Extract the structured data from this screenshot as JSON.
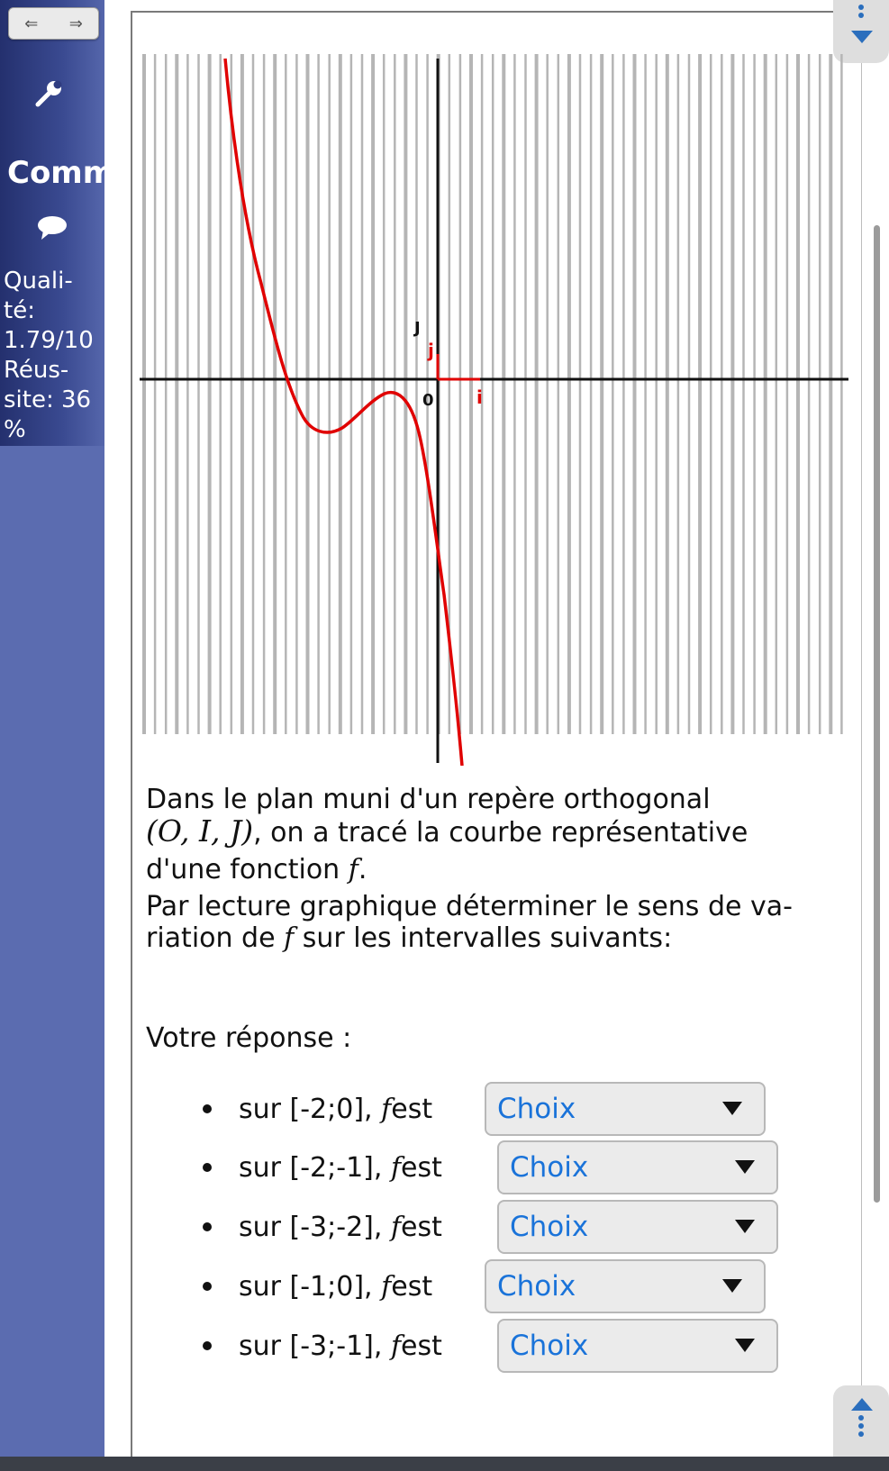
{
  "sidebar": {
    "nav_left": "⇐",
    "nav_right": "⇒",
    "section_title": "Comm",
    "stats_lines": [
      "Quali-",
      "té:",
      "1.79/10",
      "Réus-",
      "site: 36",
      "%"
    ],
    "colors": {
      "sidebar_top": "#24306e",
      "sidebar": "#5b6cb0"
    }
  },
  "graph": {
    "label_J_black": "J",
    "label_j_red": "j",
    "label_origin": "0",
    "label_i_red": "i",
    "curve_color": "#e00000",
    "grid_color": "#b5b5b5"
  },
  "question": {
    "line1": "Dans le plan muni d'un repère orthogonal",
    "line2_math": "(O, I, J)",
    "line2_text": ", on a tracé la courbe représentative",
    "line3_text": "d'une fonction ",
    "line3_math": "f",
    "line3_end": ".",
    "line4": "Par lecture graphique déterminer le sens de va-",
    "line5_start": "riation de ",
    "line5_math": "f",
    "line5_end": " sur les intervalles suivants:"
  },
  "answer_label": "Votre réponse :",
  "answers": [
    {
      "prefix": "sur [-2;0], ",
      "var": "f",
      "suffix": " est",
      "select_value": "Choix"
    },
    {
      "prefix": "sur [-2;-1], ",
      "var": "f",
      "suffix": " est",
      "select_value": "Choix"
    },
    {
      "prefix": "sur [-3;-2], ",
      "var": "f",
      "suffix": " est",
      "select_value": "Choix"
    },
    {
      "prefix": "sur [-1;0], ",
      "var": "f",
      "suffix": " est",
      "select_value": "Choix"
    },
    {
      "prefix": "sur [-3;-1], ",
      "var": "f",
      "suffix": " est",
      "select_value": "Choix"
    }
  ]
}
